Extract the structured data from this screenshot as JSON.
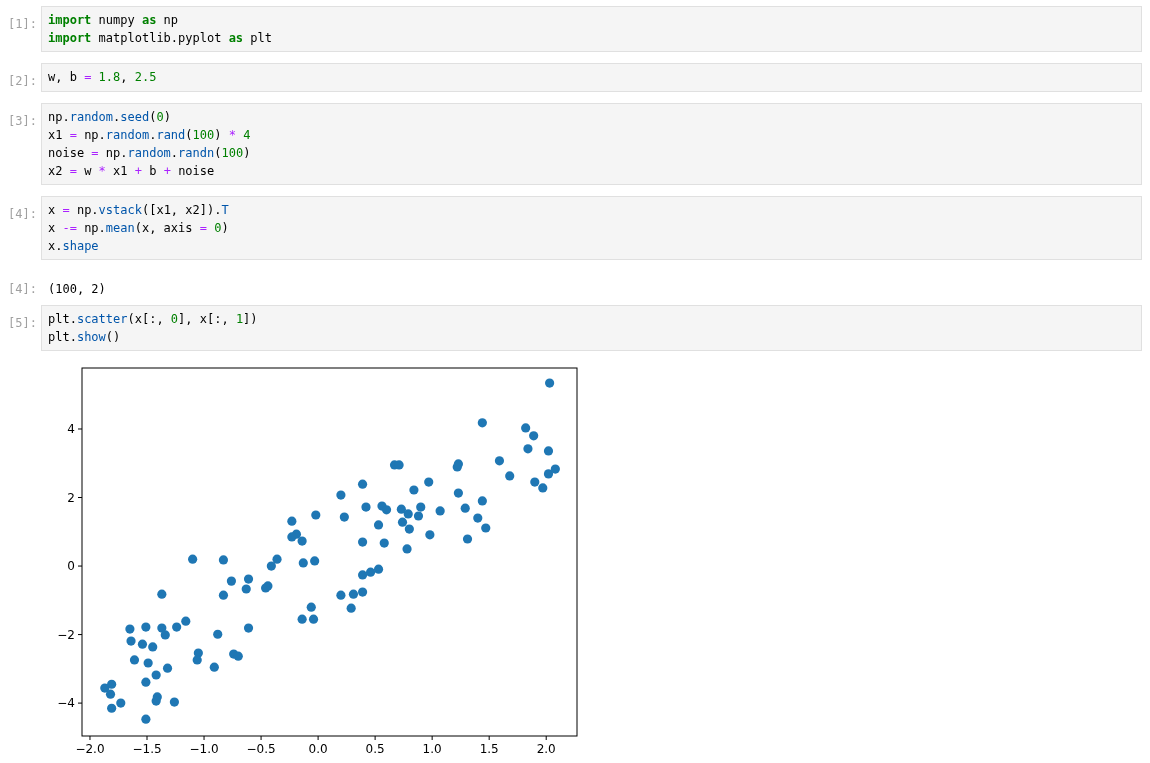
{
  "cells": [
    {
      "kind": "input",
      "prompt": "[1]:",
      "lines": [
        [
          {
            "text": "import",
            "kind": "keyword"
          },
          {
            "text": " numpy ",
            "kind": "plain"
          },
          {
            "text": "as",
            "kind": "keyword"
          },
          {
            "text": " np",
            "kind": "plain"
          }
        ],
        [
          {
            "text": "import",
            "kind": "keyword"
          },
          {
            "text": " matplotlib.pyplot ",
            "kind": "plain"
          },
          {
            "text": "as",
            "kind": "keyword"
          },
          {
            "text": " plt",
            "kind": "plain"
          }
        ]
      ]
    },
    {
      "kind": "input",
      "prompt": "[2]:",
      "lines": [
        [
          {
            "text": "w, b ",
            "kind": "plain"
          },
          {
            "text": "=",
            "kind": "operator"
          },
          {
            "text": " 1.8",
            "kind": "number"
          },
          {
            "text": ", ",
            "kind": "plain"
          },
          {
            "text": "2.5",
            "kind": "number"
          }
        ]
      ]
    },
    {
      "kind": "input",
      "prompt": "[3]:",
      "lines": [
        [
          {
            "text": "np.",
            "kind": "plain"
          },
          {
            "text": "random",
            "kind": "attribute"
          },
          {
            "text": ".",
            "kind": "plain"
          },
          {
            "text": "seed",
            "kind": "attribute"
          },
          {
            "text": "(",
            "kind": "plain"
          },
          {
            "text": "0",
            "kind": "number"
          },
          {
            "text": ")",
            "kind": "plain"
          }
        ],
        [
          {
            "text": "x1 ",
            "kind": "plain"
          },
          {
            "text": "=",
            "kind": "operator"
          },
          {
            "text": " np.",
            "kind": "plain"
          },
          {
            "text": "random",
            "kind": "attribute"
          },
          {
            "text": ".",
            "kind": "plain"
          },
          {
            "text": "rand",
            "kind": "attribute"
          },
          {
            "text": "(",
            "kind": "plain"
          },
          {
            "text": "100",
            "kind": "number"
          },
          {
            "text": ") ",
            "kind": "plain"
          },
          {
            "text": "*",
            "kind": "operator"
          },
          {
            "text": " 4",
            "kind": "number"
          }
        ],
        [
          {
            "text": "noise ",
            "kind": "plain"
          },
          {
            "text": "=",
            "kind": "operator"
          },
          {
            "text": " np.",
            "kind": "plain"
          },
          {
            "text": "random",
            "kind": "attribute"
          },
          {
            "text": ".",
            "kind": "plain"
          },
          {
            "text": "randn",
            "kind": "attribute"
          },
          {
            "text": "(",
            "kind": "plain"
          },
          {
            "text": "100",
            "kind": "number"
          },
          {
            "text": ")",
            "kind": "plain"
          }
        ],
        [
          {
            "text": "x2 ",
            "kind": "plain"
          },
          {
            "text": "=",
            "kind": "operator"
          },
          {
            "text": " w ",
            "kind": "plain"
          },
          {
            "text": "*",
            "kind": "operator"
          },
          {
            "text": " x1 ",
            "kind": "plain"
          },
          {
            "text": "+",
            "kind": "operator"
          },
          {
            "text": " b ",
            "kind": "plain"
          },
          {
            "text": "+",
            "kind": "operator"
          },
          {
            "text": " noise",
            "kind": "plain"
          }
        ]
      ]
    },
    {
      "kind": "input",
      "prompt": "[4]:",
      "lines": [
        [
          {
            "text": "x ",
            "kind": "plain"
          },
          {
            "text": "=",
            "kind": "operator"
          },
          {
            "text": " np.",
            "kind": "plain"
          },
          {
            "text": "vstack",
            "kind": "attribute"
          },
          {
            "text": "([x1, x2]).",
            "kind": "plain"
          },
          {
            "text": "T",
            "kind": "attribute"
          }
        ],
        [
          {
            "text": "x ",
            "kind": "plain"
          },
          {
            "text": "-=",
            "kind": "operator"
          },
          {
            "text": " np.",
            "kind": "plain"
          },
          {
            "text": "mean",
            "kind": "attribute"
          },
          {
            "text": "(x, axis ",
            "kind": "plain"
          },
          {
            "text": "=",
            "kind": "operator"
          },
          {
            "text": " 0",
            "kind": "number"
          },
          {
            "text": ")",
            "kind": "plain"
          }
        ],
        [
          {
            "text": "x.",
            "kind": "plain"
          },
          {
            "text": "shape",
            "kind": "attribute"
          }
        ]
      ]
    },
    {
      "kind": "output",
      "prompt": "[4]:",
      "text": "(100, 2)"
    },
    {
      "kind": "input",
      "prompt": "[5]:",
      "lines": [
        [
          {
            "text": "plt.",
            "kind": "plain"
          },
          {
            "text": "scatter",
            "kind": "attribute"
          },
          {
            "text": "(x[:, ",
            "kind": "plain"
          },
          {
            "text": "0",
            "kind": "number"
          },
          {
            "text": "], x[:, ",
            "kind": "plain"
          },
          {
            "text": "1",
            "kind": "number"
          },
          {
            "text": "])",
            "kind": "plain"
          }
        ],
        [
          {
            "text": "plt.",
            "kind": "plain"
          },
          {
            "text": "show",
            "kind": "attribute"
          },
          {
            "text": "()",
            "kind": "plain"
          }
        ]
      ]
    },
    {
      "kind": "figure",
      "chart_data": {
        "type": "scatter",
        "x": [
          2.03,
          1.44,
          1.82,
          1.89,
          1.84,
          2.02,
          1.59,
          1.68,
          2.02,
          2.08,
          1.9,
          1.97,
          0.67,
          0.71,
          1.22,
          1.23,
          0.39,
          0.97,
          0.84,
          0.2,
          1.23,
          1.44,
          0.42,
          0.56,
          0.6,
          0.73,
          0.79,
          0.9,
          0.88,
          1.07,
          1.29,
          0.23,
          0.53,
          0.74,
          0.8,
          1.4,
          1.47,
          0.98,
          1.31,
          0.39,
          0.58,
          0.78,
          0.53,
          0.46,
          0.39,
          0.2,
          0.31,
          0.39,
          0.29,
          -0.02,
          -0.23,
          -0.19,
          -0.23,
          -0.14,
          -0.36,
          -0.41,
          -0.13,
          -0.03,
          -1.1,
          -0.83,
          -0.76,
          -0.61,
          -0.63,
          -0.83,
          -0.44,
          -0.46,
          -1.37,
          -0.06,
          -0.14,
          -0.04,
          -1.16,
          -1.24,
          -1.37,
          -1.34,
          -1.51,
          -1.65,
          -0.88,
          -0.61,
          -1.64,
          -1.54,
          -1.45,
          -1.61,
          -1.49,
          -1.05,
          -1.06,
          -0.74,
          -0.7,
          -1.32,
          -1.42,
          -0.91,
          -1.51,
          -1.81,
          -1.87,
          -1.82,
          -1.41,
          -1.42,
          -1.73,
          -1.26,
          -1.81,
          -1.51
        ],
        "series": [
          {
            "color": "#1f77b4",
            "values": [
              5.34,
              4.18,
              4.03,
              3.8,
              3.42,
              3.36,
              3.07,
              2.63,
              2.69,
              2.83,
              2.45,
              2.28,
              2.95,
              2.95,
              2.89,
              2.98,
              2.39,
              2.45,
              2.22,
              2.07,
              2.13,
              1.9,
              1.72,
              1.75,
              1.64,
              1.66,
              1.52,
              1.72,
              1.46,
              1.61,
              1.69,
              1.43,
              1.2,
              1.28,
              1.08,
              1.4,
              1.11,
              0.91,
              0.79,
              0.7,
              0.67,
              0.5,
              -0.09,
              -0.18,
              -0.26,
              -0.85,
              -0.82,
              -0.76,
              -1.23,
              1.49,
              1.31,
              0.93,
              0.85,
              0.73,
              0.2,
              0.0,
              0.09,
              0.15,
              0.2,
              0.18,
              -0.44,
              -0.38,
              -0.67,
              -0.85,
              -0.58,
              -0.64,
              -0.82,
              -1.2,
              -1.55,
              -1.55,
              -1.61,
              -1.78,
              -1.81,
              -2.01,
              -1.78,
              -1.84,
              -1.99,
              -1.81,
              -2.19,
              -2.28,
              -2.36,
              -2.74,
              -2.83,
              -2.54,
              -2.74,
              -2.57,
              -2.63,
              -2.98,
              -3.18,
              -2.95,
              -3.39,
              -3.45,
              -3.56,
              -3.74,
              -3.82,
              -3.94,
              -4.0,
              -3.97,
              -4.15,
              -4.47
            ]
          }
        ],
        "xlim": [
          -2.07,
          2.27
        ],
        "ylim": [
          -4.96,
          5.78
        ],
        "xticks": [
          {
            "value": -2,
            "label": "−2.0"
          },
          {
            "value": -1.5,
            "label": "−1.5"
          },
          {
            "value": -1,
            "label": "−1.0"
          },
          {
            "value": -0.5,
            "label": "−0.5"
          },
          {
            "value": 0,
            "label": "0.0"
          },
          {
            "value": 0.5,
            "label": "0.5"
          },
          {
            "value": 1,
            "label": "1.0"
          },
          {
            "value": 1.5,
            "label": "1.5"
          },
          {
            "value": 2,
            "label": "2.0"
          }
        ],
        "yticks": [
          {
            "value": -4,
            "label": "−4"
          },
          {
            "value": -2,
            "label": "−2"
          },
          {
            "value": 0,
            "label": "0"
          },
          {
            "value": 2,
            "label": "2"
          },
          {
            "value": 4,
            "label": "4"
          }
        ]
      }
    }
  ]
}
